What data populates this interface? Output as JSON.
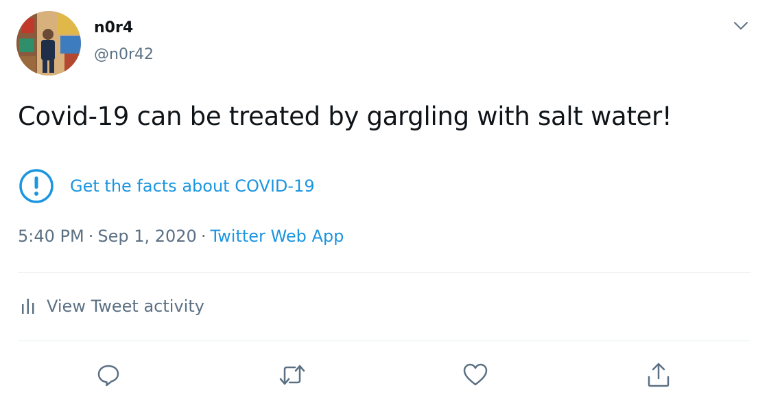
{
  "user": {
    "display_name": "n0r4",
    "handle": "@n0r42"
  },
  "tweet": {
    "text": "Covid-19 can be treated by gargling with salt water!"
  },
  "notice": {
    "icon": "exclamation-circle-icon",
    "link_text": "Get the facts about COVID-19"
  },
  "meta": {
    "time": "5:40 PM",
    "separator": "·",
    "date": "Sep 1, 2020",
    "source": "Twitter Web App"
  },
  "activity": {
    "icon": "bar-chart-icon",
    "label": "View Tweet activity"
  },
  "actions": {
    "reply_icon": "reply-icon",
    "retweet_icon": "retweet-icon",
    "like_icon": "heart-icon",
    "share_icon": "share-icon"
  },
  "colors": {
    "text_primary": "#0f1419",
    "text_secondary": "#5b7083",
    "link": "#1b95e0",
    "divider": "#e6ecf0"
  }
}
